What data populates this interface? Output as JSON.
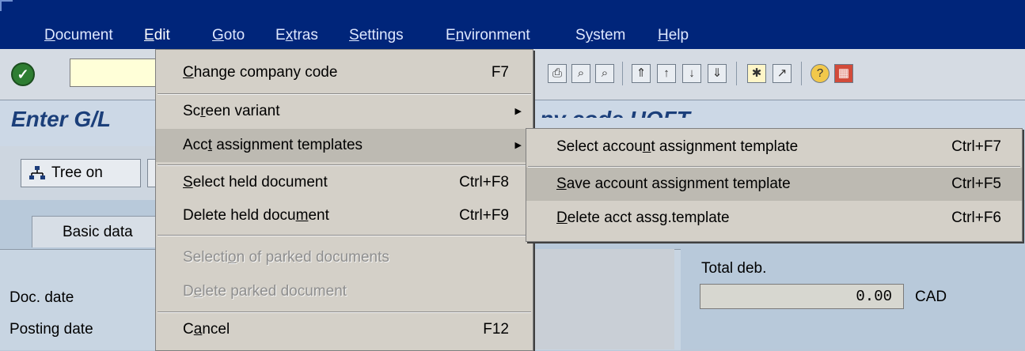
{
  "menubar": {
    "items": [
      "Document",
      "Edit",
      "Goto",
      "Extras",
      "Settings",
      "Environment",
      "System",
      "Help"
    ]
  },
  "toolbar": {
    "icons": [
      "print-icon",
      "find-icon",
      "find-next-icon",
      "first-page-icon",
      "previous-page-icon",
      "next-page-icon",
      "last-page-icon",
      "create-session-icon",
      "shortcut-icon",
      "help-icon",
      "layout-menu-icon"
    ]
  },
  "title": {
    "text": "Enter G/L",
    "hidden_tail": "ny code UOFT"
  },
  "app_toolbar": {
    "tree_button": "Tree on"
  },
  "tab": {
    "label": "Basic data"
  },
  "fields": {
    "doc_date_label": "Doc. date",
    "posting_date_label": "Posting date",
    "total_deb_label": "Total deb.",
    "total_deb_value": "0.00",
    "currency": "CAD"
  },
  "edit_menu": {
    "change_company_code": {
      "label": "Change company code",
      "shortcut": "F7"
    },
    "screen_variant": {
      "label": "Screen variant"
    },
    "acct_assignment_templates": {
      "label": "Acct assignment templates"
    },
    "select_held_document": {
      "label": "Select held document",
      "shortcut": "Ctrl+F8"
    },
    "delete_held_document": {
      "label": "Delete held document",
      "shortcut": "Ctrl+F9"
    },
    "selection_parked": {
      "label": "Selection of parked documents"
    },
    "delete_parked": {
      "label": "Delete parked document"
    },
    "cancel": {
      "label": "Cancel",
      "shortcut": "F12"
    }
  },
  "sub_menu": {
    "select_template": {
      "label": "Select account assignment template",
      "shortcut": "Ctrl+F7"
    },
    "save_template": {
      "label": "Save account assignment template",
      "shortcut": "Ctrl+F5"
    },
    "delete_template": {
      "label": "Delete acct assg.template",
      "shortcut": "Ctrl+F6"
    }
  }
}
